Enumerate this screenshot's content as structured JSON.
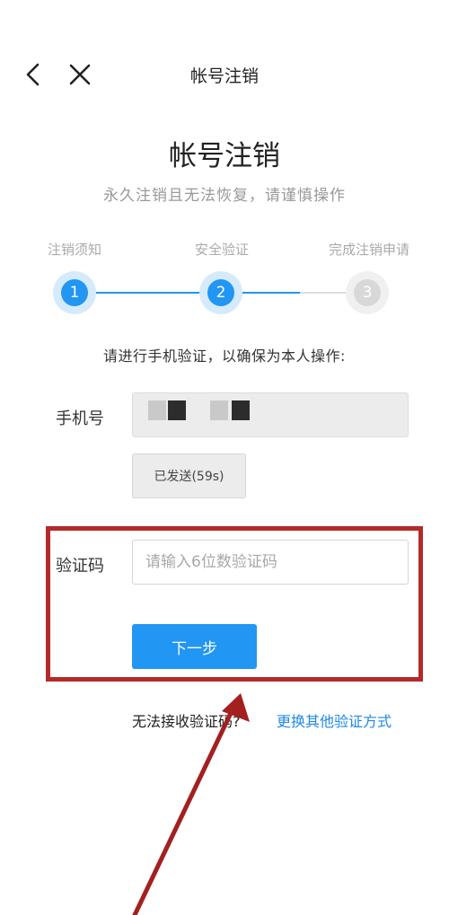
{
  "nav": {
    "back_icon": "chevron-left-icon",
    "close_icon": "close-icon",
    "title": "帐号注销"
  },
  "header": {
    "title": "帐号注销",
    "subtitle": "永久注销且无法恢复，请谨慎操作"
  },
  "steps": [
    {
      "label": "注销须知",
      "number": "1",
      "state": "done"
    },
    {
      "label": "安全验证",
      "number": "2",
      "state": "active"
    },
    {
      "label": "完成注销申请",
      "number": "3",
      "state": "pending"
    }
  ],
  "instruction": "请进行手机验证，以确保为本人操作:",
  "phone": {
    "label": "手机号"
  },
  "sent_button": {
    "label": "已发送(59s)"
  },
  "code": {
    "label": "验证码",
    "placeholder": "请输入6位数验证码",
    "value": ""
  },
  "next_button": {
    "label": "下一步"
  },
  "footer": {
    "prompt": "无法接收验证码?",
    "link": "更换其他验证方式"
  },
  "colors": {
    "accent": "#2196f3",
    "link": "#1e88e5",
    "annotation": "#b42a2a",
    "pending_step": "#d8d8d8"
  }
}
